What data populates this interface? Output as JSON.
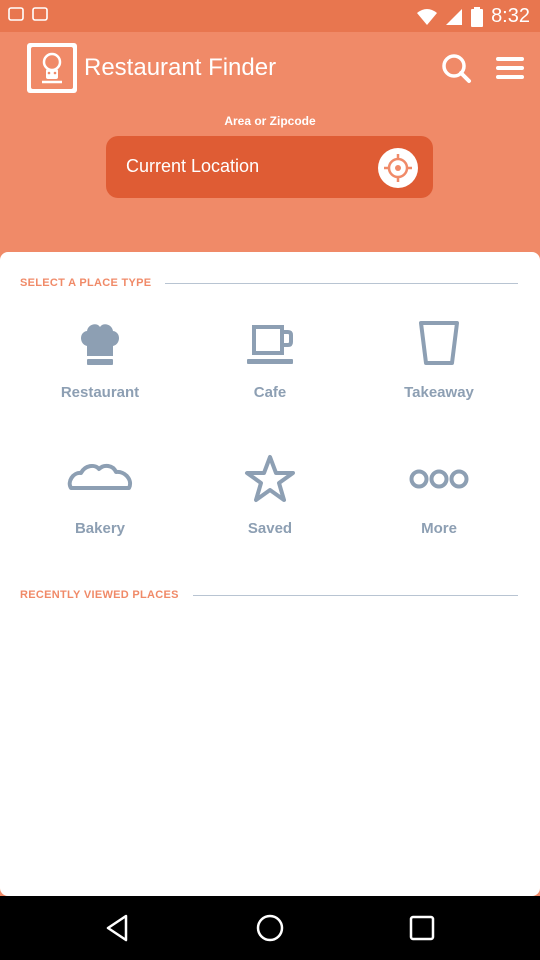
{
  "status_bar": {
    "time": "8:32"
  },
  "header": {
    "app_title": "Restaurant Finder",
    "search_icon": "search-icon",
    "menu_icon": "menu-icon",
    "area_label": "Area or Zipcode",
    "location_value": "Current Location",
    "locate_icon": "crosshair-icon"
  },
  "place_section": {
    "title": "SELECT A PLACE TYPE",
    "places": [
      {
        "label": "Restaurant",
        "icon": "chef-hat-icon"
      },
      {
        "label": "Cafe",
        "icon": "coffee-cup-icon"
      },
      {
        "label": "Takeaway",
        "icon": "takeaway-cup-icon"
      },
      {
        "label": "Bakery",
        "icon": "bread-icon"
      },
      {
        "label": "Saved",
        "icon": "star-icon"
      },
      {
        "label": "More",
        "icon": "more-dots-icon"
      }
    ]
  },
  "recent_section": {
    "title": "RECENTLY VIEWED PLACES"
  },
  "colors": {
    "brand": "#f08a68",
    "status_bar": "#e8764f",
    "input_bg": "#df5c34",
    "icon_gray": "#8d9fb3"
  }
}
